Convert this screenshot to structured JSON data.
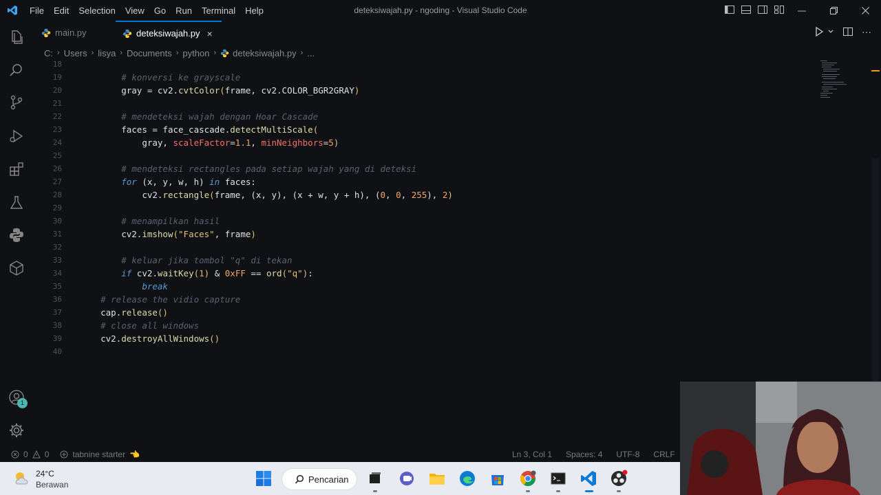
{
  "window": {
    "title": "deteksiwajah.py - ngoding - Visual Studio Code",
    "menu": [
      "File",
      "Edit",
      "Selection",
      "View",
      "Go",
      "Run",
      "Terminal",
      "Help"
    ]
  },
  "tabs": [
    {
      "label": "main.py",
      "active": false
    },
    {
      "label": "deteksiwajah.py",
      "active": true,
      "close": "×"
    }
  ],
  "breadcrumb": [
    "C:",
    "Users",
    "lisya",
    "Documents",
    "python",
    "deteksiwajah.py",
    "..."
  ],
  "editor": {
    "lines": [
      {
        "n": "18",
        "indent": "",
        "tokens": []
      },
      {
        "n": "19",
        "indent": "        ",
        "tokens": [
          {
            "t": "# konversi ke grayscale",
            "c": "cm"
          }
        ]
      },
      {
        "n": "20",
        "indent": "        ",
        "tokens": [
          {
            "t": "gray = cv2.",
            "c": "vr"
          },
          {
            "t": "cvtColor",
            "c": "fn"
          },
          {
            "t": "(",
            "c": "br"
          },
          {
            "t": "frame, cv2.COLOR_BGR2GRAY",
            "c": "vr"
          },
          {
            "t": ")",
            "c": "br"
          }
        ]
      },
      {
        "n": "21",
        "indent": "",
        "tokens": []
      },
      {
        "n": "22",
        "indent": "        ",
        "tokens": [
          {
            "t": "# mendeteksi wajah dengan Hoar Cascade",
            "c": "cm"
          }
        ]
      },
      {
        "n": "23",
        "indent": "        ",
        "tokens": [
          {
            "t": "faces = face_cascade.",
            "c": "vr"
          },
          {
            "t": "detectMultiScale",
            "c": "fn"
          },
          {
            "t": "(",
            "c": "br"
          }
        ]
      },
      {
        "n": "24",
        "indent": "            ",
        "tokens": [
          {
            "t": "gray, ",
            "c": "vr"
          },
          {
            "t": "scaleFactor",
            "c": "pr"
          },
          {
            "t": "=",
            "c": "vr"
          },
          {
            "t": "1.1",
            "c": "nm"
          },
          {
            "t": ", ",
            "c": "vr"
          },
          {
            "t": "minNeighbors",
            "c": "pr"
          },
          {
            "t": "=",
            "c": "vr"
          },
          {
            "t": "5",
            "c": "nm"
          },
          {
            "t": ")",
            "c": "br"
          }
        ]
      },
      {
        "n": "25",
        "indent": "",
        "tokens": []
      },
      {
        "n": "26",
        "indent": "        ",
        "tokens": [
          {
            "t": "# mendeteksi rectangles pada setiap wajah yang di deteksi",
            "c": "cm"
          }
        ]
      },
      {
        "n": "27",
        "indent": "        ",
        "tokens": [
          {
            "t": "for",
            "c": "kw"
          },
          {
            "t": " (x, y, w, h) ",
            "c": "vr"
          },
          {
            "t": "in",
            "c": "kw"
          },
          {
            "t": " faces:",
            "c": "vr"
          }
        ]
      },
      {
        "n": "28",
        "indent": "            ",
        "tokens": [
          {
            "t": "cv2.",
            "c": "vr"
          },
          {
            "t": "rectangle",
            "c": "fn"
          },
          {
            "t": "(",
            "c": "br"
          },
          {
            "t": "frame, (x, y), (x + w, y + h), (",
            "c": "vr"
          },
          {
            "t": "0",
            "c": "nm"
          },
          {
            "t": ", ",
            "c": "vr"
          },
          {
            "t": "0",
            "c": "nm"
          },
          {
            "t": ", ",
            "c": "vr"
          },
          {
            "t": "255",
            "c": "nm"
          },
          {
            "t": "), ",
            "c": "vr"
          },
          {
            "t": "2",
            "c": "nm"
          },
          {
            "t": ")",
            "c": "br"
          }
        ]
      },
      {
        "n": "29",
        "indent": "",
        "tokens": []
      },
      {
        "n": "30",
        "indent": "        ",
        "tokens": [
          {
            "t": "# menampilkan hasil",
            "c": "cm"
          }
        ]
      },
      {
        "n": "31",
        "indent": "        ",
        "tokens": [
          {
            "t": "cv2.",
            "c": "vr"
          },
          {
            "t": "imshow",
            "c": "fn"
          },
          {
            "t": "(",
            "c": "br"
          },
          {
            "t": "\"Faces\"",
            "c": "st"
          },
          {
            "t": ", frame",
            "c": "vr"
          },
          {
            "t": ")",
            "c": "br"
          }
        ]
      },
      {
        "n": "32",
        "indent": "",
        "tokens": []
      },
      {
        "n": "33",
        "indent": "        ",
        "tokens": [
          {
            "t": "# keluar jika tombol \"q\" di tekan",
            "c": "cm"
          }
        ]
      },
      {
        "n": "34",
        "indent": "        ",
        "tokens": [
          {
            "t": "if",
            "c": "kw"
          },
          {
            "t": " cv2.",
            "c": "vr"
          },
          {
            "t": "waitKey",
            "c": "fn"
          },
          {
            "t": "(",
            "c": "br"
          },
          {
            "t": "1",
            "c": "nm"
          },
          {
            "t": ")",
            "c": "br"
          },
          {
            "t": " & ",
            "c": "vr"
          },
          {
            "t": "0xFF",
            "c": "nm"
          },
          {
            "t": " == ",
            "c": "vr"
          },
          {
            "t": "ord",
            "c": "fn"
          },
          {
            "t": "(",
            "c": "br"
          },
          {
            "t": "\"q\"",
            "c": "st"
          },
          {
            "t": ")",
            "c": "br"
          },
          {
            "t": ":",
            "c": "vr"
          }
        ]
      },
      {
        "n": "35",
        "indent": "            ",
        "tokens": [
          {
            "t": "break",
            "c": "kw"
          }
        ]
      },
      {
        "n": "36",
        "indent": "    ",
        "tokens": [
          {
            "t": "# release the vidio capture",
            "c": "cm"
          }
        ]
      },
      {
        "n": "37",
        "indent": "    ",
        "tokens": [
          {
            "t": "cap.",
            "c": "vr"
          },
          {
            "t": "release",
            "c": "fn"
          },
          {
            "t": "()",
            "c": "br"
          }
        ]
      },
      {
        "n": "38",
        "indent": "    ",
        "tokens": [
          {
            "t": "# close all windows",
            "c": "cm"
          }
        ]
      },
      {
        "n": "39",
        "indent": "    ",
        "tokens": [
          {
            "t": "cv2.",
            "c": "vr"
          },
          {
            "t": "destroyAllWindows",
            "c": "fn"
          },
          {
            "t": "()",
            "c": "br"
          }
        ]
      },
      {
        "n": "40",
        "indent": "",
        "tokens": []
      }
    ]
  },
  "activity_bar": {
    "icons": [
      "explorer-icon",
      "search-icon",
      "source-control-icon",
      "run-debug-icon",
      "extensions-icon",
      "testing-icon",
      "python-icon",
      "remote-explorer-icon"
    ],
    "accounts_badge": "1"
  },
  "status_bar": {
    "errors": "0",
    "warnings": "0",
    "tabnine": "tabnine starter",
    "position": "Ln 3, Col 1",
    "spaces": "Spaces: 4",
    "encoding": "UTF-8",
    "eol": "CRLF"
  },
  "taskbar": {
    "temperature": "24°C",
    "weather": "Berawan",
    "search": "Pencarian",
    "apps": [
      "windows-start",
      "search",
      "file-explorer",
      "teams",
      "folder",
      "edge",
      "store",
      "chrome",
      "terminal",
      "vscode",
      "obs"
    ]
  },
  "colors": {
    "background": "#0f1114",
    "accent": "#0078d4",
    "comment": "#5a6170",
    "keyword": "#569cd6",
    "function": "#dcdcaa",
    "param": "#f47067",
    "number": "#f0a868",
    "string": "#e5c07b"
  }
}
